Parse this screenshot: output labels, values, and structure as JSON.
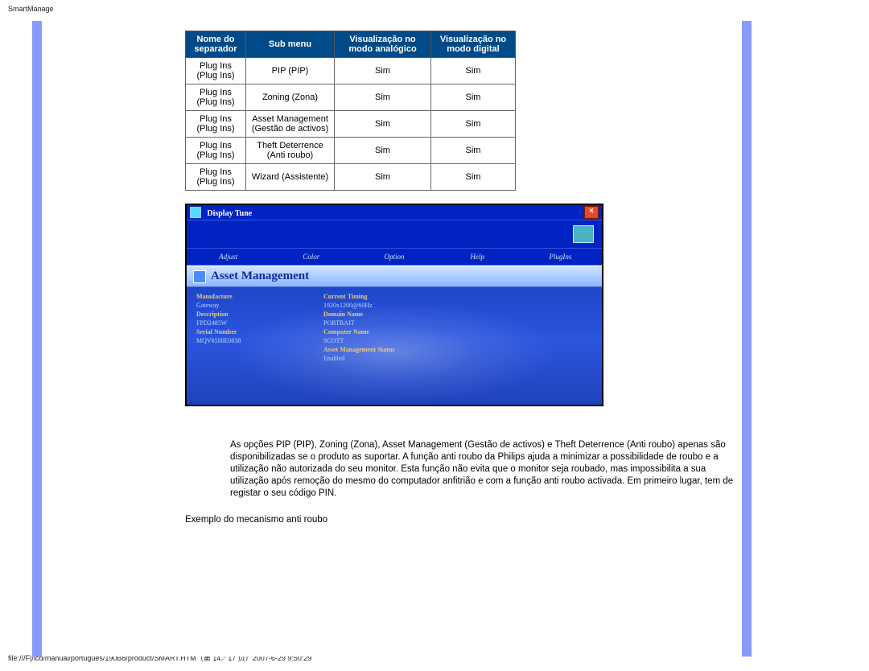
{
  "page": {
    "title": "SmartManage"
  },
  "footer": "file:///F|/lcd/manual/portugues/190B8/product/SMART.HTM（第 14／17 页）2007-6-29 9:50:29",
  "table": {
    "headers": [
      "Nome do separador",
      "Sub menu",
      "Visualização no modo analógico",
      "Visualização no modo digital"
    ],
    "rows": [
      {
        "tab": "Plug Ins (Plug Ins)",
        "sub": "PIP (PIP)",
        "an": "Sim",
        "dg": "Sim"
      },
      {
        "tab": "Plug Ins (Plug Ins)",
        "sub": "Zoning (Zona)",
        "an": "Sim",
        "dg": "Sim"
      },
      {
        "tab": "Plug Ins (Plug Ins)",
        "sub": "Asset Management (Gestão de activos)",
        "an": "Sim",
        "dg": "Sim"
      },
      {
        "tab": "Plug Ins (Plug Ins)",
        "sub": "Theft Deterrence (Anti roubo)",
        "an": "Sim",
        "dg": "Sim"
      },
      {
        "tab": "Plug Ins (Plug Ins)",
        "sub": "Wizard (Assistente)",
        "an": "Sim",
        "dg": "Sim"
      }
    ]
  },
  "shot": {
    "close_glyph": "×",
    "title": "Display Tune",
    "tabs": [
      "Adjust",
      "Color",
      "Option",
      "Help",
      "PlugIns"
    ],
    "header": "Asset Management",
    "left": [
      {
        "lbl": "Manufacture",
        "val": "Gateway"
      },
      {
        "lbl": "Description",
        "val": "FPD2485W"
      },
      {
        "lbl": "Serial Number",
        "val": "MQV6500E0038"
      }
    ],
    "right": [
      {
        "lbl": "Current Timing",
        "val": "1920x1200@60Hz"
      },
      {
        "lbl": "Domain Name",
        "val": "PORTRAIT"
      },
      {
        "lbl": "Computer Name",
        "val": "SCOTT"
      },
      {
        "lbl": "Asset Management Status",
        "val": "Enabled"
      }
    ]
  },
  "paragraph": "As opções PIP (PIP), Zoning (Zona), Asset Management (Gestão de activos) e Theft Deterrence (Anti roubo) apenas são disponibilizadas se o produto as suportar. A função anti roubo da Philips ajuda a minimizar a possibilidade de roubo e a utilização não autorizada do seu monitor. Esta função não evita que o monitor seja roubado, mas impossibilita a sua utilização após remoção do mesmo do computador anfitrião e com a função anti roubo activada. Em primeiro lugar, tem de registar o seu código PIN.",
  "subheading": "Exemplo do mecanismo anti roubo"
}
